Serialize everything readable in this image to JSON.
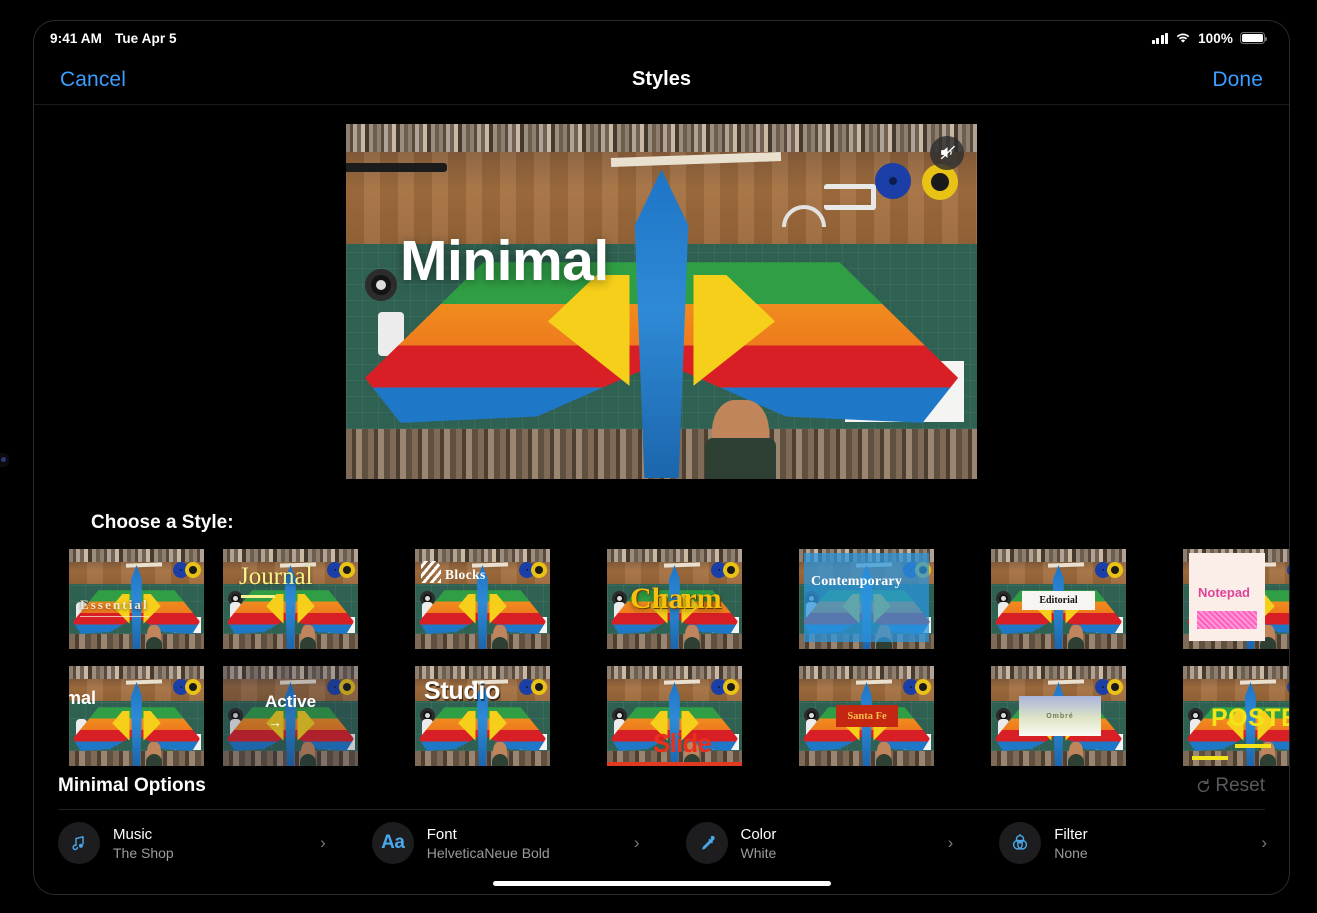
{
  "status_bar": {
    "time": "9:41 AM",
    "date": "Tue Apr 5",
    "battery_percent": "100%",
    "cellular_icon": "signal-bars-icon",
    "wifi_icon": "wifi-icon",
    "battery_icon": "battery-full-icon"
  },
  "nav": {
    "cancel_label": "Cancel",
    "title": "Styles",
    "done_label": "Done"
  },
  "preview": {
    "title_overlay": "Minimal",
    "mute_icon": "speaker-mute-icon"
  },
  "styles_section": {
    "heading": "Choose a Style:",
    "row1": [
      {
        "name": "Essential",
        "selected": false
      },
      {
        "name": "Journal",
        "selected": false
      },
      {
        "name": "Blocks",
        "selected": false
      },
      {
        "name": "Charm",
        "selected": false
      },
      {
        "name": "Contemporary",
        "selected": false
      },
      {
        "name": "Editorial",
        "selected": false
      },
      {
        "name": "Notepad",
        "selected": false
      }
    ],
    "row2": [
      {
        "name": "Minimal",
        "selected": true,
        "selection_color": "#4aa8e8"
      },
      {
        "name": "Active",
        "selected": false
      },
      {
        "name": "Studio",
        "selected": true,
        "selection_color": "#e8a33d"
      },
      {
        "name": "Slide",
        "selected": false
      },
      {
        "name": "Santa Fe",
        "selected": false
      },
      {
        "name": "Ombré",
        "selected": false
      },
      {
        "name": "POSTER",
        "selected": false
      }
    ]
  },
  "options": {
    "title": "Minimal Options",
    "reset_label": "Reset",
    "reset_icon": "refresh-icon",
    "items": [
      {
        "icon": "music-note-icon",
        "name": "Music",
        "value": "The Shop",
        "chevron": "›"
      },
      {
        "icon": "font-aa-icon",
        "name": "Font",
        "value": "HelveticaNeue Bold",
        "chevron": "›"
      },
      {
        "icon": "eyedropper-icon",
        "name": "Color",
        "value": "White",
        "chevron": "›"
      },
      {
        "icon": "filter-circles-icon",
        "name": "Filter",
        "value": "None",
        "chevron": "›"
      }
    ]
  },
  "colors": {
    "accent_blue": "#3b9dff",
    "selection_blue": "#4aa8e8",
    "selection_orange": "#e8a33d",
    "background": "#000000"
  }
}
